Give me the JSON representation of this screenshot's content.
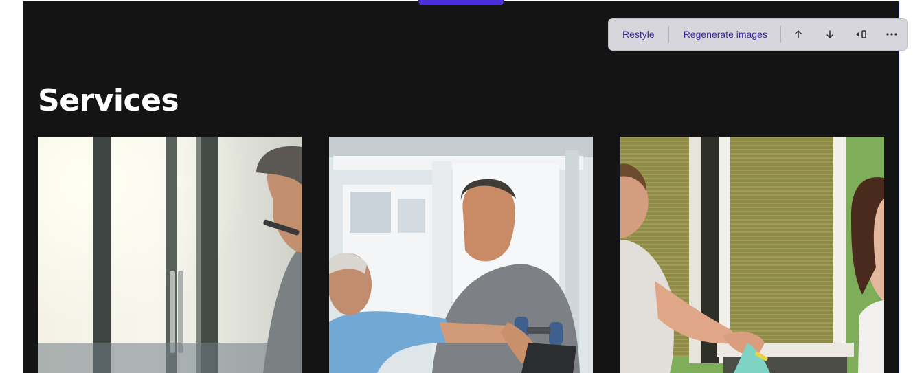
{
  "section": {
    "title": "Services"
  },
  "toolbar": {
    "restyle_label": "Restyle",
    "regenerate_label": "Regenerate images",
    "icons": [
      "arrow-up-icon",
      "arrow-down-icon",
      "audio-panel-icon",
      "more-icon"
    ]
  },
  "cards": [
    {
      "image": "physio-consult-photo"
    },
    {
      "image": "senior-dumbbell-exercise-photo"
    },
    {
      "image": "therapist-taping-knee-photo"
    }
  ],
  "colors": {
    "section_bg": "#131413",
    "accent": "#4b2ed6",
    "toolbar_bg": "#d7d6dd",
    "toolbar_text": "#3b2a9a",
    "outline": "#8e95ff"
  }
}
